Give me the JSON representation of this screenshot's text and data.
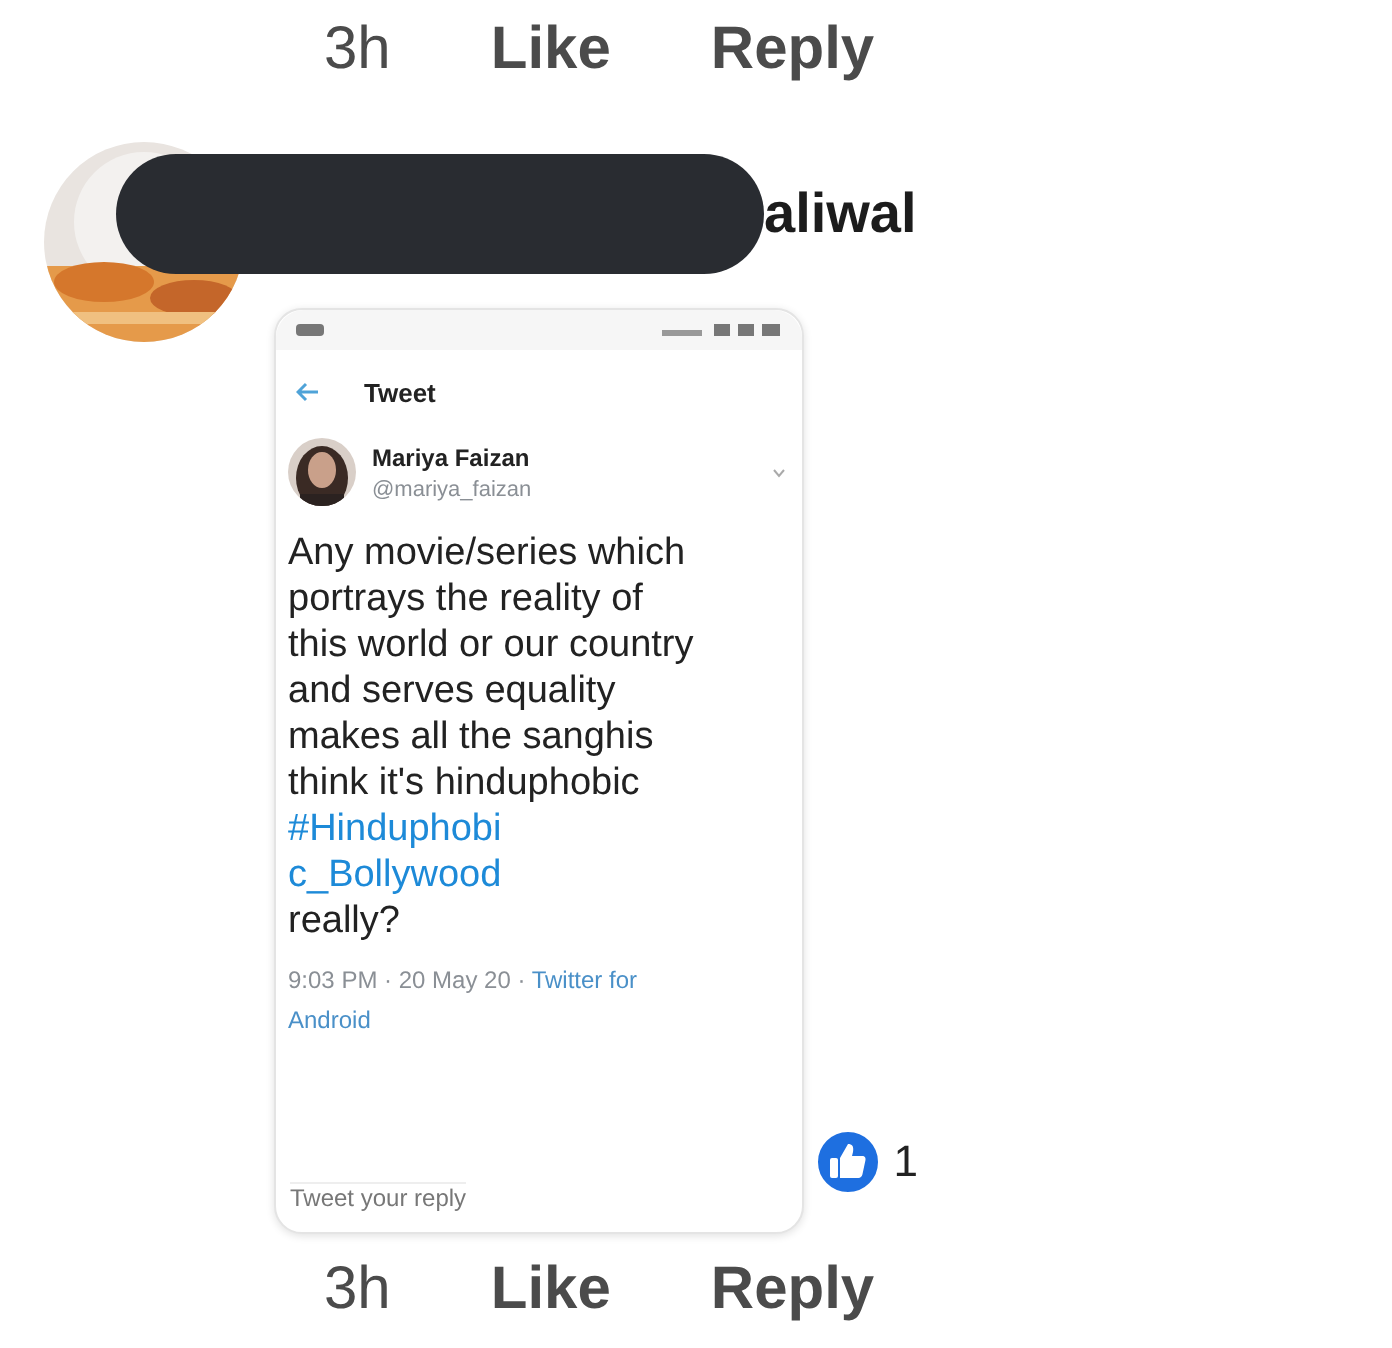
{
  "top_actions": {
    "time": "3h",
    "like": "Like",
    "reply": "Reply"
  },
  "comment": {
    "author": "aliwal",
    "redacted": true,
    "tweet_screenshot": {
      "header": "Tweet",
      "user_name": "Mariya Faizan",
      "handle": "@mariya_faizan",
      "lines": [
        {
          "kind": "text",
          "text": "Any movie/series  which"
        },
        {
          "kind": "text",
          "text": "portrays the reality of"
        },
        {
          "kind": "text",
          "text": "this world or our country"
        },
        {
          "kind": "text",
          "text": "and serves equality"
        },
        {
          "kind": "text",
          "text": "makes all the sanghis"
        },
        {
          "kind": "text",
          "text": "think it's hinduphobic"
        },
        {
          "kind": "hashtag",
          "text": "#Hinduphobi"
        },
        {
          "kind": "hashtag",
          "text": "c_Bollywood"
        },
        {
          "kind": "text",
          "text": "really?"
        }
      ],
      "timestamp": "9:03 PM · 20 May 20 ·",
      "source": "Twitter for Android",
      "reply_placeholder": "Tweet your reply"
    },
    "reactions": {
      "count": "1"
    }
  },
  "bottom_actions": {
    "time": "3h",
    "like": "Like",
    "reply": "Reply"
  }
}
